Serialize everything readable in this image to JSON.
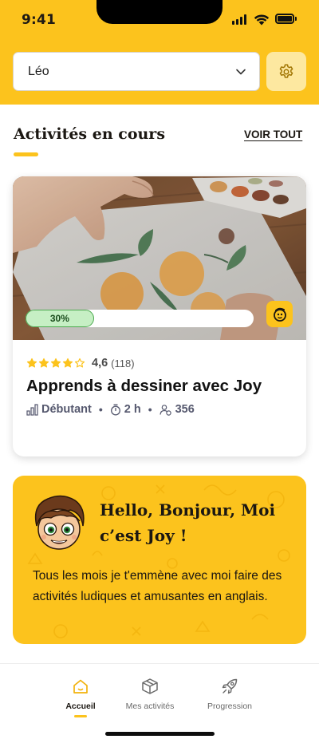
{
  "status_bar": {
    "time": "9:41"
  },
  "header": {
    "profile_name": "Léo"
  },
  "section": {
    "title": "Activités en cours",
    "see_all": "VOIR TOUT"
  },
  "activity": {
    "progress_label": "30%",
    "progress_value": 0.3,
    "rating": "4,6",
    "rating_count": "(118)",
    "stars_filled": 4,
    "stars_total": 5,
    "title": "Apprends à dessiner avec Joy",
    "level": "Débutant",
    "duration": "2 h",
    "participants": "356"
  },
  "promo": {
    "title": "Hello, Bonjour, Moi c’est Joy !",
    "text": "Tous les mois je t'emmène avec moi faire des activités ludiques et amusantes en anglais."
  },
  "nav": {
    "home": "Accueil",
    "activities": "Mes activités",
    "progress": "Progression"
  },
  "colors": {
    "brand_yellow": "#fcc31d",
    "progress_green": "#4caa4f",
    "meta_text": "#55586e"
  },
  "icons": [
    "chevron-down-icon",
    "gear-icon",
    "star-icon",
    "level-bars-icon",
    "timer-icon",
    "people-icon",
    "joy-badge-icon",
    "home-icon",
    "box-icon",
    "rocket-icon"
  ]
}
